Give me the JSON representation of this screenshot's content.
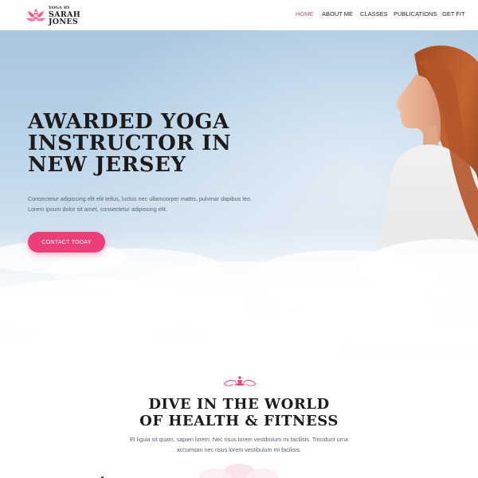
{
  "header": {
    "logo": {
      "top_text": "YOGA BY",
      "line1": "SARAH",
      "line2": "JONES",
      "icon": "lotus-meditation-icon",
      "color": "#ec3f77"
    },
    "nav": [
      {
        "label": "HOME",
        "active": true
      },
      {
        "label": "ABOUT ME",
        "active": false
      },
      {
        "label": "CLASSES",
        "active": false
      },
      {
        "label": "PUBLICATIONS",
        "active": false
      },
      {
        "label": "GET FIT",
        "active": false
      }
    ]
  },
  "hero": {
    "title": "AWARDED YOGA\nINSTRUCTOR IN\nNEW JERSEY",
    "text": "Consectetur adipiscing elit elit tellus, luctus nec ullamcorper mattis, pulvinar dapibus leo. Lorem ipsum dolor sit amet, consectetur adipiscing elit.",
    "cta_label": "CONTACT TODAY",
    "image": "woman-meditating-in-clouds"
  },
  "section": {
    "ornament_icon": "lotus-ornament-icon",
    "title": "DIVE IN THE WORLD\nOF HEALTH & FITNESS",
    "text": "Et ligula sit quam, sapien lorem. Nec risus lorem vestibulum mi facilisis. Tincidunt urna accumsan nec risus lorem vestibulum mi facilisis."
  },
  "colors": {
    "accent": "#ec3f77",
    "text_dark": "#1c1c1c",
    "text_muted": "#5a6470",
    "sky": "#b7d1e6"
  }
}
